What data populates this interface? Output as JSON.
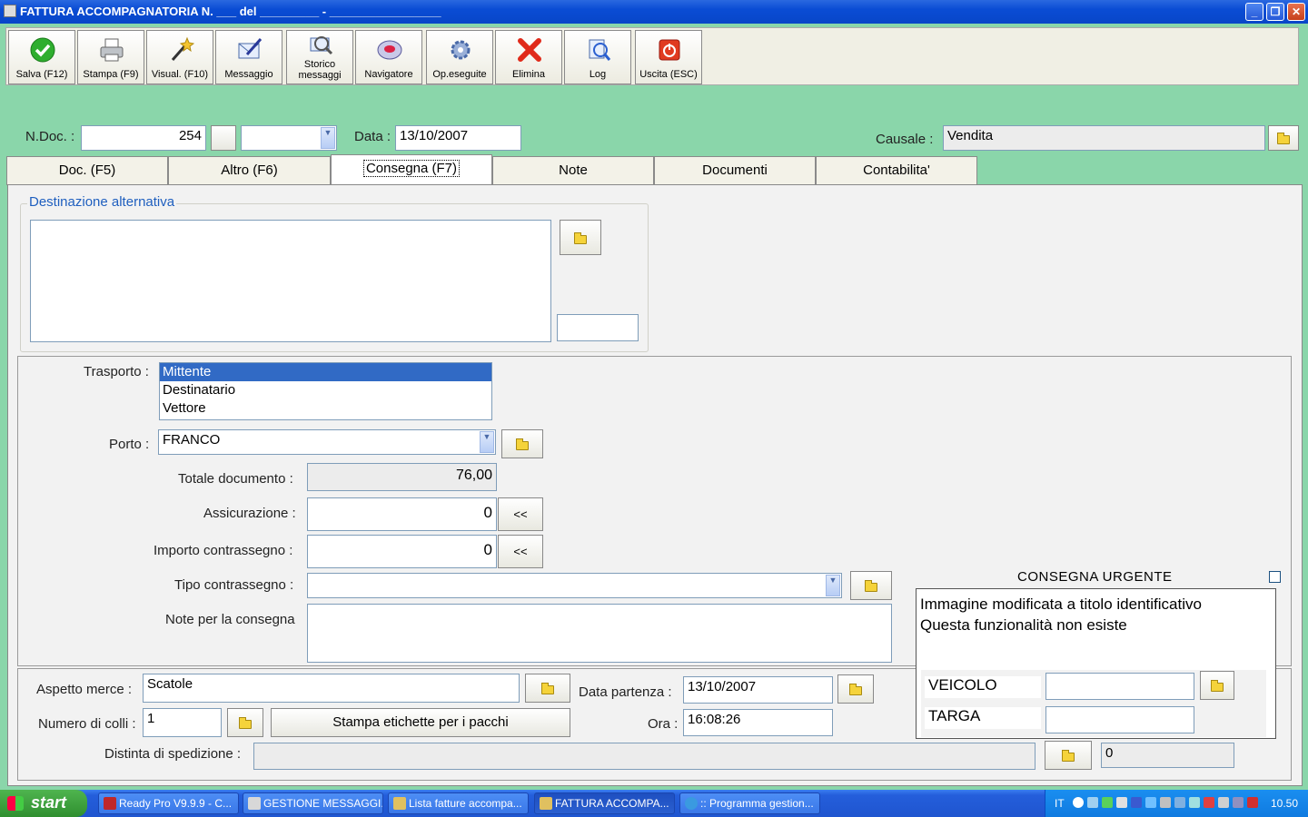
{
  "window": {
    "title": "FATTURA ACCOMPAGNATORIA N. ___ del _________ - _________________"
  },
  "toolbar": [
    {
      "label": "Salva (F12)",
      "icon": "checkmark-icon"
    },
    {
      "label": "Stampa (F9)",
      "icon": "printer-icon"
    },
    {
      "label": "Visual. (F10)",
      "icon": "magic-wand-icon"
    },
    {
      "label": "Messaggio",
      "icon": "message-pen-icon"
    },
    {
      "label": "Storico messaggi",
      "icon": "history-search-icon"
    },
    {
      "label": "Navigatore",
      "icon": "navigator-icon"
    },
    {
      "label": "Op.eseguite",
      "icon": "operations-icon"
    },
    {
      "label": "Elimina",
      "icon": "delete-x-icon"
    },
    {
      "label": "Log",
      "icon": "log-icon"
    },
    {
      "label": "Uscita (ESC)",
      "icon": "exit-power-icon"
    }
  ],
  "header": {
    "ndoc_label": "N.Doc. :",
    "ndoc_value": "254",
    "data_label": "Data :",
    "data_value": "13/10/2007",
    "causale_label": "Causale :",
    "causale_value": "Vendita"
  },
  "tabs": [
    "Doc. (F5)",
    "Altro (F6)",
    "Consegna (F7)",
    "Note",
    "Documenti",
    "Contabilita'"
  ],
  "active_tab": "Consegna (F7)",
  "destinazione": {
    "title": "Destinazione alternativa",
    "text": "",
    "code": ""
  },
  "trasporto": {
    "label": "Trasporto :",
    "options": [
      "Mittente",
      "Destinatario",
      "Vettore"
    ],
    "selected": "Mittente"
  },
  "porto": {
    "label": "Porto :",
    "value": "FRANCO"
  },
  "totale": {
    "label": "Totale documento :",
    "value": "76,00"
  },
  "assicurazione": {
    "label": "Assicurazione :",
    "value": "0",
    "button": "<<"
  },
  "contrassegno": {
    "label": "Importo contrassegno :",
    "value": "0",
    "button": "<<"
  },
  "tipo_contrassegno": {
    "label": "Tipo contrassegno :",
    "value": ""
  },
  "note_consegna": {
    "label": "Note per la consegna",
    "value": ""
  },
  "urgente": {
    "title": "CONSEGNA URGENTE",
    "line1": "Immagine modificata a titolo identificativo",
    "line2": "Questa funzionalità non esiste",
    "veicolo_label": "VEICOLO",
    "targa_label": "TARGA"
  },
  "aspetto": {
    "label": "Aspetto merce :",
    "value": "Scatole"
  },
  "colli": {
    "label": "Numero di colli :",
    "value": "1"
  },
  "stampa_etichette": "Stampa etichette per i pacchi",
  "partenza": {
    "label": "Data partenza :",
    "value": "13/10/2007"
  },
  "ora": {
    "label": "Ora :",
    "value": "16:08:26"
  },
  "distinta": {
    "label": "Distinta di spedizione :",
    "value": "",
    "number": "0"
  },
  "taskbar": {
    "start": "start",
    "tasks": [
      {
        "label": "Ready Pro V9.9.9 - C...",
        "color": "#c0282a"
      },
      {
        "label": "GESTIONE MESSAGGI...",
        "color": "#d8d8d8"
      },
      {
        "label": "Lista fatture accompa...",
        "color": "#e0c060"
      },
      {
        "label": "FATTURA ACCOMPA...",
        "color": "#e0c060"
      },
      {
        "label": ":: Programma gestion...",
        "color": "#3a9ae0"
      }
    ],
    "lang": "IT",
    "clock": "10.50"
  }
}
